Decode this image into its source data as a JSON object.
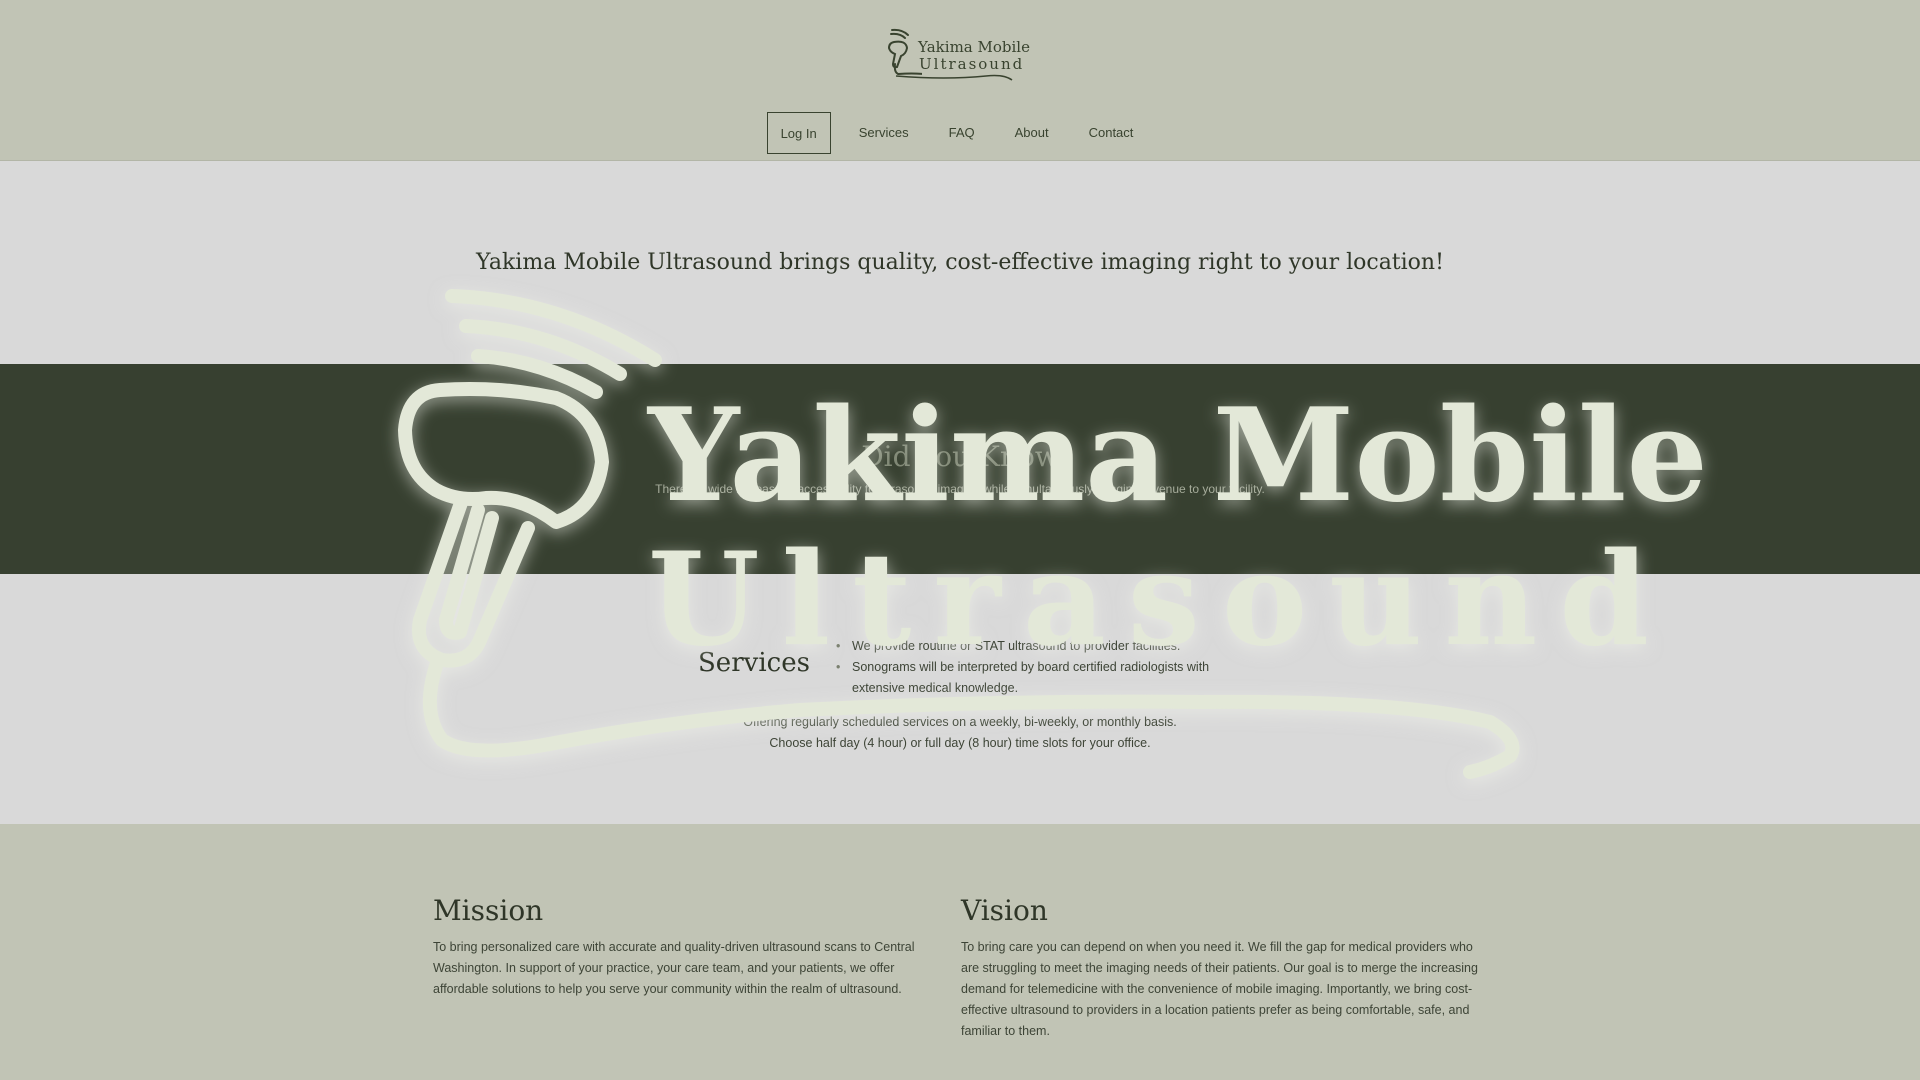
{
  "header": {
    "brand_line1": "Yakima Mobile",
    "brand_line2": "Ultrasound",
    "nav": [
      "Log In",
      "Services",
      "FAQ",
      "About",
      "Contact"
    ]
  },
  "hero": {
    "tagline": "Yakima Mobile Ultrasound brings quality, cost-effective imaging right to your location!"
  },
  "did_you_know": {
    "title": "Did you Know",
    "text": "There's a wide increase in accessibility to ultrasound imaging while simultaneously bringing revenue to your facility."
  },
  "overlay": {
    "line1": "Yakima Mobile",
    "line2": "Ultrasound"
  },
  "services": {
    "title": "Services",
    "items": [
      "We provide routine or STAT ultrasound to provider facilities.",
      "Sonograms will be interpreted by board certified radiologists with extensive medical knowledge."
    ],
    "note_line1": "Offering regularly scheduled services on a weekly, bi-weekly, or monthly basis.",
    "note_line2": "Choose half day (4 hour) or full day (8 hour) time slots for your office."
  },
  "mission": {
    "title": "Mission",
    "text": "To bring personalized care with accurate and quality-driven ultrasound scans to Central Washington. In support of your practice, your care team, and your patients, we offer affordable solutions to help you serve your community within the realm of ultrasound."
  },
  "vision": {
    "title": "Vision",
    "text": "To bring care you can depend on when you need it. We fill the gap for medical providers who are struggling to meet the imaging needs of their patients. Our goal is to merge the increasing demand for telemedicine with the convenience of mobile imaging. Importantly, we bring cost-effective ultrasound to providers in a location patients prefer as being comfortable, safe, and familiar to them."
  },
  "colors": {
    "sage": "#c1c4b5",
    "light_band": "#d9d9d9",
    "dark_band": "#374030",
    "overlay_cream": "#e3e8d8"
  },
  "icons": {
    "logo": "ultrasound-probe-icon"
  }
}
